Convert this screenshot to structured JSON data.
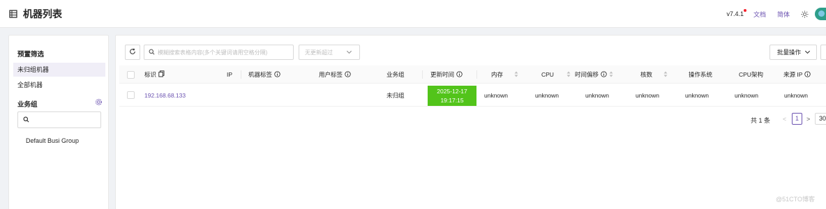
{
  "header": {
    "title": "机器列表",
    "version": "v7.4.1",
    "docs_label": "文档",
    "lang_label": "简体",
    "page_icon": "list-icon",
    "theme_icon": "sun-icon"
  },
  "sidebar": {
    "preset_title": "预置筛选",
    "preset_items": [
      "未归组机器",
      "全部机器"
    ],
    "active_index": 0,
    "group_title": "业务组",
    "group_settings_icon": "gear-icon",
    "search_placeholder": "",
    "groups": [
      "Default Busi Group"
    ]
  },
  "toolbar": {
    "search_placeholder": "模糊搜索表格内容(多个关键词请用空格分隔)",
    "filter_value": "无更新超过",
    "batch_label": "批量操作"
  },
  "table": {
    "headers": {
      "ident": "标识",
      "ip": "IP",
      "tags": "机器标签",
      "user_tags": "用户标签",
      "group": "业务组",
      "update_time": "更新时间",
      "mem": "内存",
      "cpu": "CPU",
      "offset": "时间偏移",
      "cores": "核数",
      "os": "操作系统",
      "arch": "CPU架构",
      "source_ip": "来源 IP"
    },
    "rows": [
      {
        "ident": "192.168.68.133",
        "group": "未归组",
        "update_date": "2025-12-17",
        "update_clock": "19:17:15",
        "mem": "unknown",
        "cpu": "unknown",
        "offset": "unknown",
        "cores": "unknown",
        "os": "unknown",
        "arch": "unknown",
        "source_ip": "unknown"
      }
    ],
    "status_color": "#52c41a"
  },
  "pagination": {
    "total": "共 1 条",
    "current_page": "1",
    "page_size": "30"
  },
  "watermark": "@51CTO博客",
  "colors": {
    "accent": "#6c53b1",
    "fresh": "#52c41a"
  }
}
